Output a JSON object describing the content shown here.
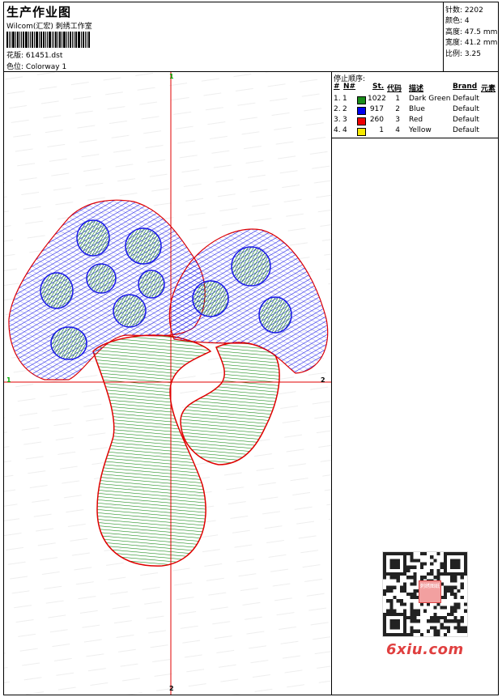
{
  "header": {
    "title": "生产作业图",
    "studio": "Wilcom(汇宏) 刺绣工作室",
    "design_label": "花版:",
    "design_value": "61451.dst",
    "colorway_label": "色位:",
    "colorway_value": "Colorway 1"
  },
  "stats": [
    {
      "label": "针数:",
      "value": "2202"
    },
    {
      "label": "颜色:",
      "value": "4"
    },
    {
      "label": "高度:",
      "value": "47.5 mm"
    },
    {
      "label": "宽度:",
      "value": "41.2 mm"
    },
    {
      "label": "比例:",
      "value": "3.25"
    }
  ],
  "axis_labels": {
    "top": "1",
    "left": "1",
    "right": "2",
    "bottom": "2"
  },
  "stop_sequence": {
    "title": "停止顺序:",
    "columns": {
      "num": "#",
      "n": "N#",
      "st": "St.",
      "code": "代码",
      "desc": "描述",
      "brand": "Brand",
      "elem": "元素"
    },
    "rows": [
      {
        "num": "1.",
        "n": "1",
        "color": "#1a8c1a",
        "st": "1022",
        "code": "1",
        "desc": "Dark Green",
        "brand": "Default"
      },
      {
        "num": "2.",
        "n": "2",
        "color": "#0000ee",
        "st": "917",
        "code": "2",
        "desc": "Blue",
        "brand": "Default"
      },
      {
        "num": "3.",
        "n": "3",
        "color": "#ee0000",
        "st": "260",
        "code": "3",
        "desc": "Red",
        "brand": "Default"
      },
      {
        "num": "4.",
        "n": "4",
        "color": "#f5e800",
        "st": "1",
        "code": "4",
        "desc": "Yellow",
        "brand": "Default"
      }
    ]
  },
  "watermark": {
    "text": "6xiu.com",
    "seal": "刺绣图纸"
  },
  "colors": {
    "green": "#1a8c1a",
    "blue": "#1a1ae8",
    "red": "#e00000",
    "axis": "#e00000"
  }
}
